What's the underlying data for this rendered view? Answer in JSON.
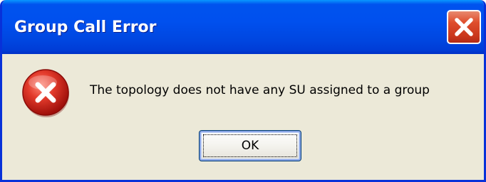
{
  "window": {
    "title": "Group Call Error"
  },
  "titlebar": {
    "close_icon": "close-icon"
  },
  "content": {
    "icon": "error-icon",
    "message": "The topology does not have any SU assigned to a group"
  },
  "buttons": {
    "ok_label": "OK"
  },
  "colors": {
    "titlebar": "#0054e3",
    "close_button": "#df4e2d",
    "error_icon": "#d8231e",
    "dialog_background": "#ece9d8"
  }
}
